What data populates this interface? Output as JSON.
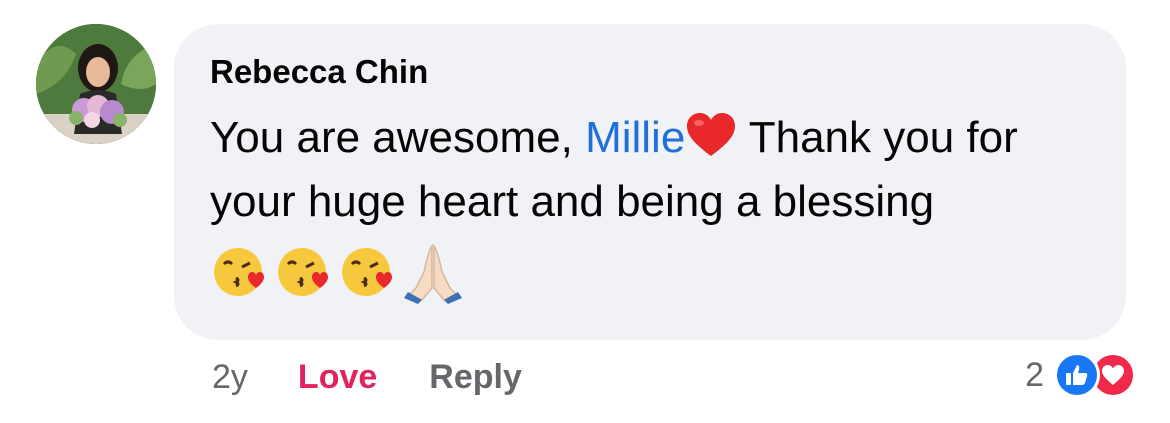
{
  "comment": {
    "author": "Rebecca Chin",
    "text_before_mention": "You are awesome, ",
    "mention": "Millie",
    "text_after_mention": " Thank you for your huge heart and being a blessing",
    "emojis": [
      "kissing-face-icon",
      "kissing-face-icon",
      "kissing-face-icon",
      "folded-hands-icon"
    ]
  },
  "meta": {
    "time": "2y",
    "love_label": "Love",
    "reply_label": "Reply"
  },
  "reactions": {
    "count": "2",
    "types": [
      "like",
      "love"
    ]
  },
  "colors": {
    "bubble": "#f0f2f5",
    "mention": "#216fdb",
    "love": "#e0245e",
    "like_icon": "#1877f2",
    "love_icon": "#f0284a"
  }
}
